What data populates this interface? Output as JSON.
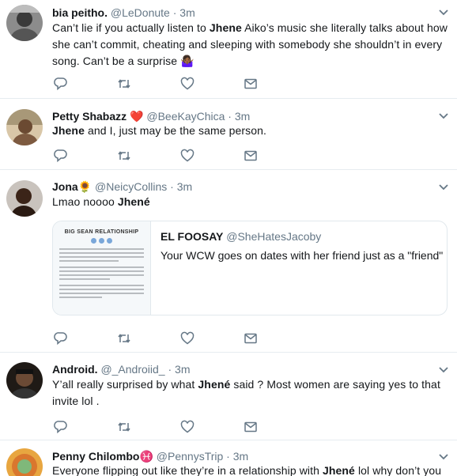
{
  "tweets": [
    {
      "name": "bia peitho.",
      "handle": "@LeDonute",
      "time": "3m",
      "text_parts": [
        "Can’t lie if you actually listen to ",
        "Jhene",
        " Aiko’s music she literally talks about how she can’t commit, cheating and sleeping with somebody she shouldn’t in every song. Can’t be a surprise",
        " 🤷🏾‍♀️"
      ]
    },
    {
      "name": "Petty Shabazz",
      "name_emoji": "❤️",
      "handle": "@BeeKayChica",
      "time": "3m",
      "text_parts": [
        "Jhene",
        " and I, just may be the same person."
      ]
    },
    {
      "name": "Jona",
      "name_emoji": "🌻",
      "handle": "@NeicyCollins",
      "time": "3m",
      "text_parts": [
        "Lmao noooo ",
        "Jhené"
      ],
      "card": {
        "thumb_title": "BIG SEAN RELATIONSHIP",
        "title_name": "EL FOOSAY",
        "title_handle": "@SheHatesJacoby",
        "description": "Your WCW goes on dates with her friend just as a \"friend\""
      }
    },
    {
      "name": "Android.",
      "handle": "@_Androiid_",
      "time": "3m",
      "text_parts": [
        "Y’all really surprised by what ",
        "Jhené",
        " said ? Most women are saying yes to that invite lol ."
      ]
    },
    {
      "name": "Penny Chilombo",
      "name_emoji": "♓",
      "handle": "@PennysTrip",
      "time": "3m",
      "text_parts": [
        "Everyone flipping out like they’re in a relationship with ",
        "Jhené",
        " lol why don’t you"
      ]
    }
  ],
  "separator": "·",
  "icons": [
    "reply-icon",
    "retweet-icon",
    "like-icon",
    "direct-message-icon",
    "chevron-down-icon"
  ],
  "colors": {
    "icon": "#657786",
    "text": "#14171a",
    "muted": "#657786",
    "divider": "#e6ecf0",
    "heart": "#e0245e"
  }
}
